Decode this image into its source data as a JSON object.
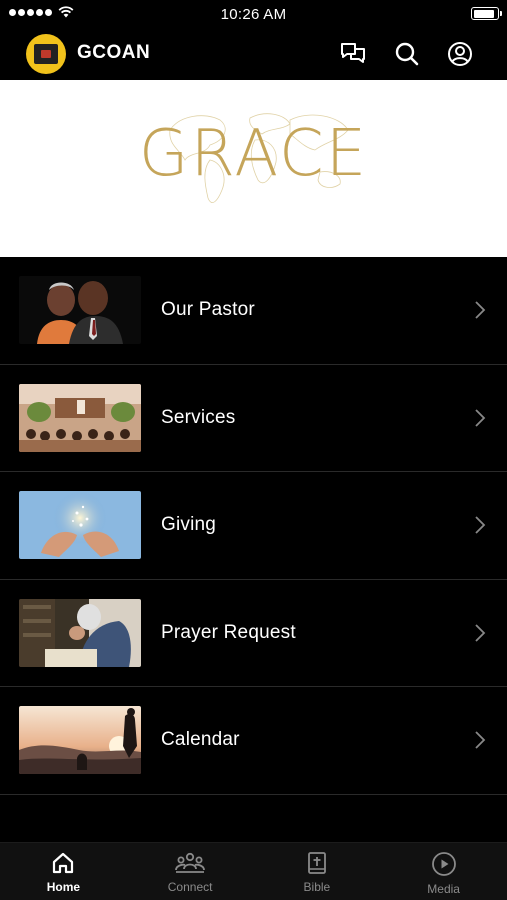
{
  "status_bar": {
    "time": "10:26 AM",
    "signal_dots": 5,
    "battery_level": 0.92
  },
  "header": {
    "app_title": "GCOAN",
    "icons": [
      "chat-icon",
      "search-icon",
      "profile-icon"
    ]
  },
  "banner": {
    "word": "GRACE",
    "accent_color": "#c5a55a"
  },
  "menu": {
    "items": [
      {
        "label": "Our Pastor",
        "thumb": "pastor-photo"
      },
      {
        "label": "Services",
        "thumb": "services-photo"
      },
      {
        "label": "Giving",
        "thumb": "giving-photo"
      },
      {
        "label": "Prayer Request",
        "thumb": "prayer-photo"
      },
      {
        "label": "Calendar",
        "thumb": "calendar-photo"
      }
    ]
  },
  "tabbar": {
    "tabs": [
      {
        "label": "Home",
        "icon": "home-icon",
        "active": true
      },
      {
        "label": "Connect",
        "icon": "people-icon",
        "active": false
      },
      {
        "label": "Bible",
        "icon": "bible-icon",
        "active": false
      },
      {
        "label": "Media",
        "icon": "play-icon",
        "active": false
      }
    ]
  },
  "colors": {
    "background": "#000000",
    "logo_yellow": "#f1c21b",
    "inactive_tab": "#8a8a8a"
  }
}
